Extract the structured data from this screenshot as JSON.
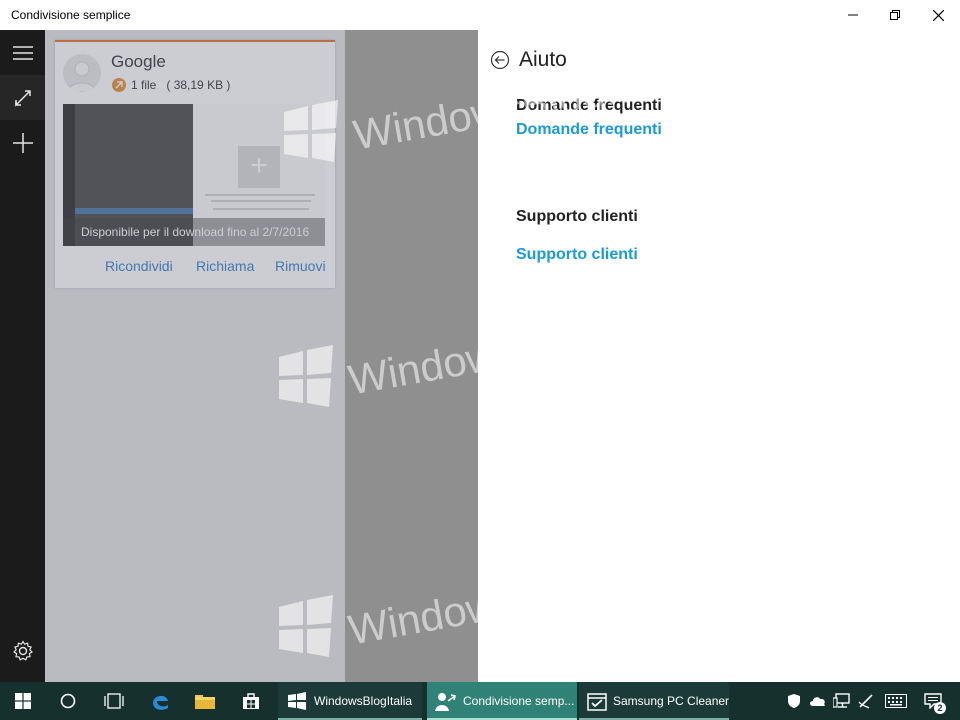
{
  "window": {
    "title": "Condivisione semplice"
  },
  "share_card": {
    "sender": "Google",
    "file_count": "1 file",
    "file_size": "( 38,19 KB )",
    "expiry": "Disponibile per il download fino al 2/7/2016",
    "actions": {
      "reshare": "Ricondividi",
      "recall": "Richiama",
      "remove": "Rimuovi"
    }
  },
  "help": {
    "title": "Aiuto",
    "faq_heading": "Domande frequenti",
    "faq_link": "Domande frequenti",
    "support_heading": "Supporto clienti",
    "support_link": "Supporto clienti"
  },
  "watermark": {
    "text": "WindowsBlogItalia"
  },
  "taskbar": {
    "apps": [
      {
        "label": "WindowsBlogItalia",
        "icon": "windows-logo-icon"
      },
      {
        "label": "Condivisione semp...",
        "icon": "share-icon",
        "active": true
      },
      {
        "label": "Samsung PC Cleaner",
        "icon": "calendar-check-icon"
      }
    ],
    "notification_count": "2"
  },
  "colors": {
    "taskbar": "#15302d",
    "accent_link": "#1a9ad6",
    "card_accent": "#e06a17",
    "rail": "#1f1f1f"
  }
}
